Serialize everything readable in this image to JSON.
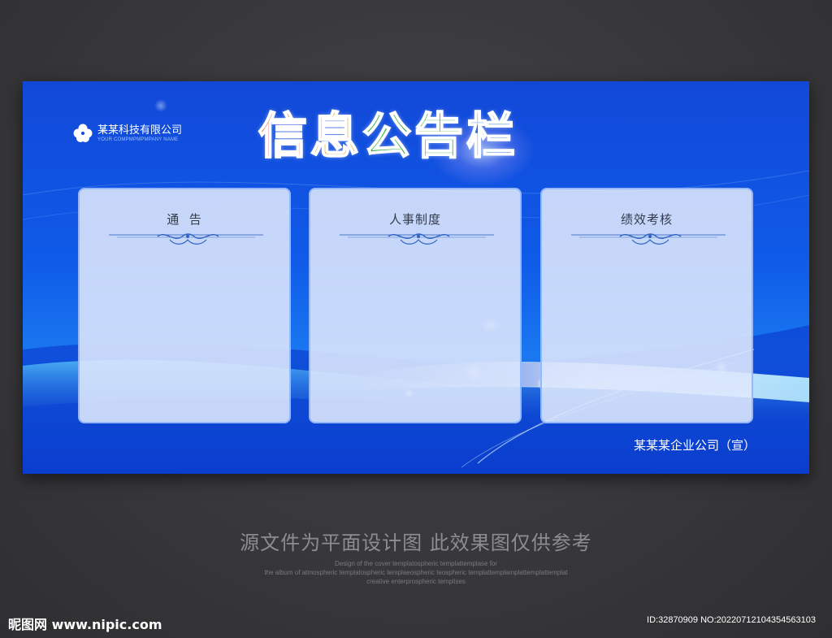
{
  "board": {
    "company_name": "某某科技有限公司",
    "company_sub": "YOUR COMPMPMPMPANY NAME",
    "title_chars": [
      "信",
      "息",
      "公",
      "告",
      "栏"
    ],
    "footer_company": "某某某企业公司（宣）"
  },
  "panels": [
    {
      "title": "通  告"
    },
    {
      "title": "人事制度"
    },
    {
      "title": "绩效考核"
    }
  ],
  "caption": {
    "main": "源文件为平面设计图 此效果图仅供参考",
    "line1": "Design of the cover templatospheric templattemplase for",
    "line2": "the album of atmospheric templatospheric templaeospheric teospheric templattemplamplattemplattemplat",
    "line3": "creative enterprospheric templises"
  },
  "watermark": {
    "text": "昵图网 www.nipic.com",
    "id": "ID:32870909 NO:20220712104354563103"
  },
  "colors": {
    "board_blue": "#1248d8",
    "title_red": "#e8341f",
    "title_gold": "#d8a51c",
    "title_green": "#2fa83c",
    "title_blue": "#1d73d6"
  }
}
